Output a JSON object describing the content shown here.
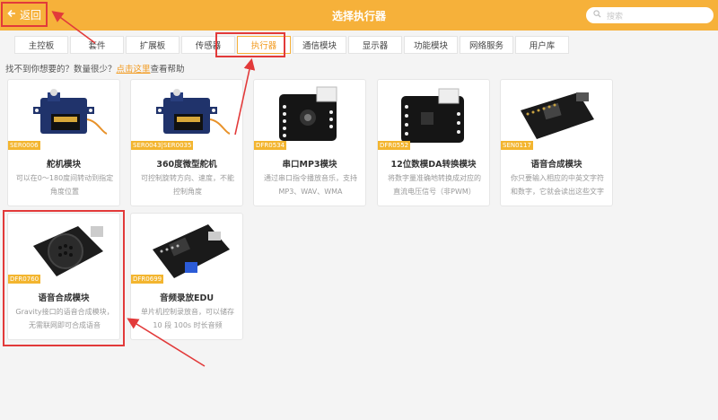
{
  "header": {
    "back_label": "返回",
    "title": "选择执行器",
    "search_placeholder": "搜索"
  },
  "tabs": [
    {
      "label": "主控板"
    },
    {
      "label": "套件"
    },
    {
      "label": "扩展板"
    },
    {
      "label": "传感器"
    },
    {
      "label": "执行器",
      "active": true
    },
    {
      "label": "通信模块"
    },
    {
      "label": "显示器"
    },
    {
      "label": "功能模块"
    },
    {
      "label": "网络服务"
    },
    {
      "label": "用户库"
    }
  ],
  "hint": {
    "prefix": "找不到你想要的？数量很少？",
    "link": "点击这里",
    "suffix": "查看帮助"
  },
  "cards": [
    {
      "code": "SER0006",
      "name": "舵机模块",
      "desc": "可以在0～180度间转动到指定角度位置"
    },
    {
      "code": "SER0043|SER0035",
      "name": "360度微型舵机",
      "desc": "可控制旋转方向、速度，不能控制角度"
    },
    {
      "code": "DFR0534",
      "name": "串口MP3模块",
      "desc": "通过串口指令播放音乐，支持MP3、WAV、WMA"
    },
    {
      "code": "DFR0552",
      "name": "12位数模DA转换模块",
      "desc": "将数字量准确地转换成对应的直流电压信号（非PWM）"
    },
    {
      "code": "SEN0117",
      "name": "语音合成模块",
      "desc": "你只要输入相应的中英文字符和数字，它就会读出这些文字"
    },
    {
      "code": "DFR0760",
      "name": "语音合成模块",
      "desc": "Gravity接口的语音合成模块，无需联网即可合成语音"
    },
    {
      "code": "DFR0699",
      "name": "音频录放EDU",
      "desc": "单片机控制录放音，可以储存10 段 100s 时长音频"
    }
  ]
}
